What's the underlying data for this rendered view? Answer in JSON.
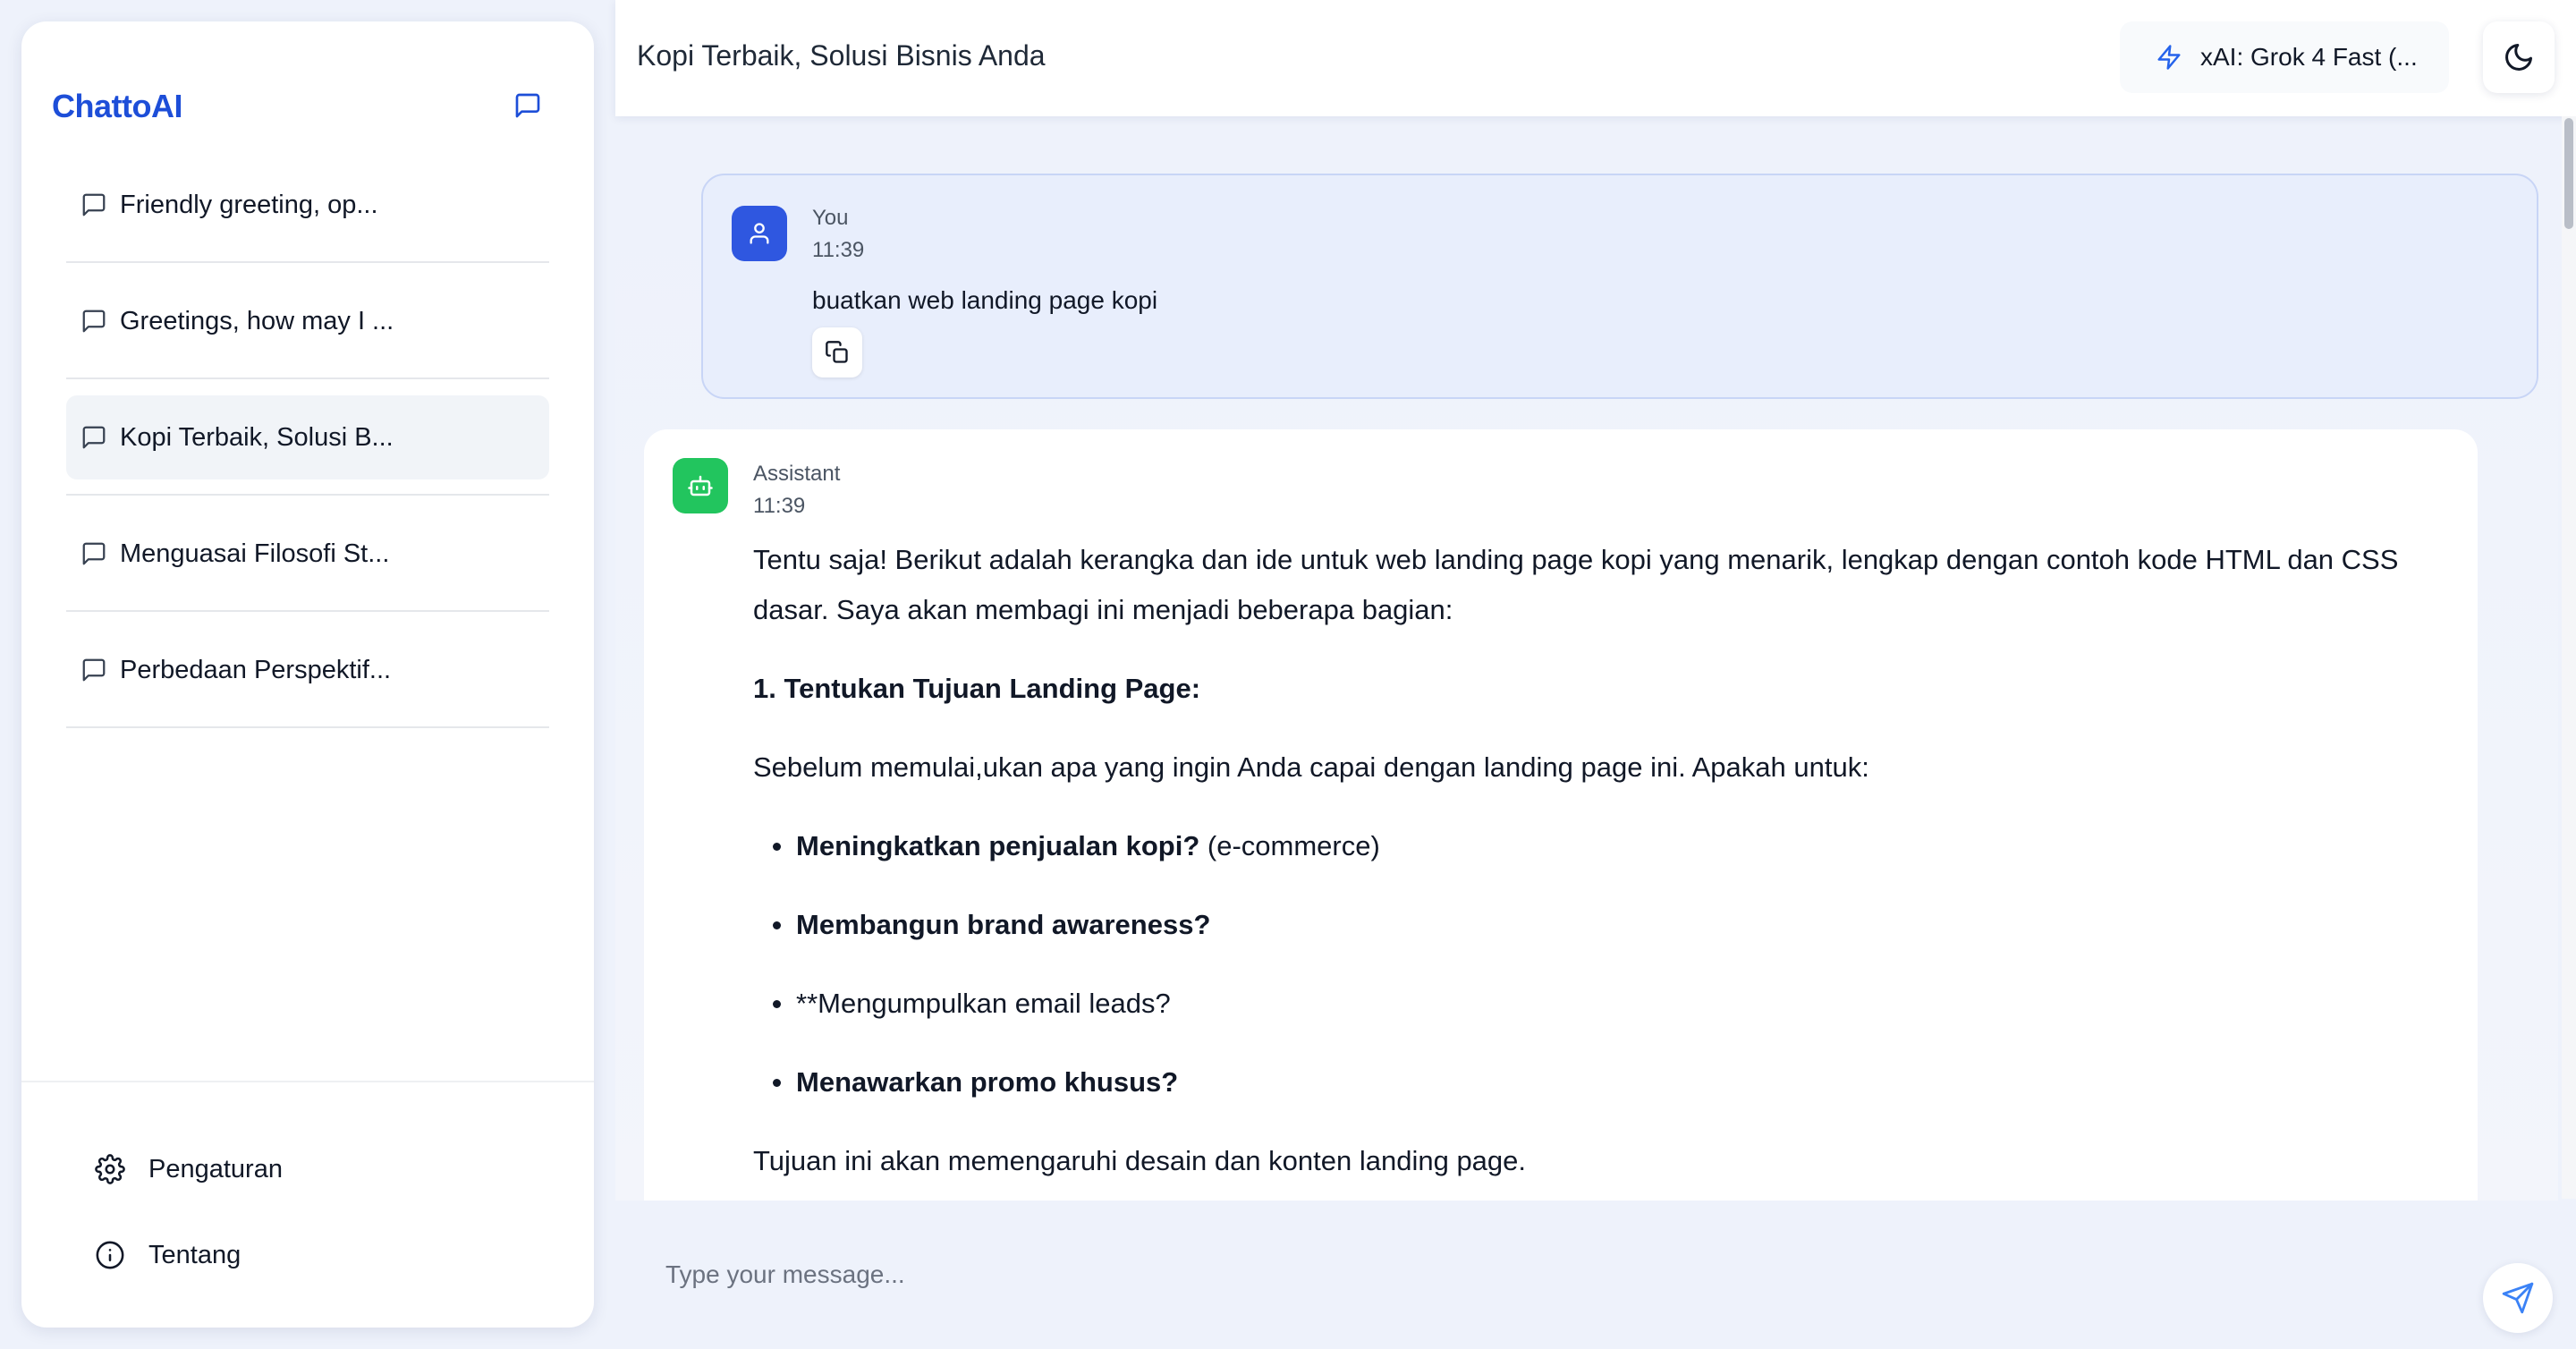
{
  "app": {
    "brand": "ChattoAI"
  },
  "sidebar": {
    "new_chat_icon": "message-square-icon",
    "chats": [
      {
        "label": "Friendly greeting, op...",
        "active": false
      },
      {
        "label": "Greetings, how may I ...",
        "active": false
      },
      {
        "label": "Kopi Terbaik, Solusi B...",
        "active": true
      },
      {
        "label": "Menguasai Filosofi St...",
        "active": false
      },
      {
        "label": "Perbedaan Perspektif...",
        "active": false
      }
    ],
    "footer": {
      "settings_label": "Pengaturan",
      "about_label": "Tentang"
    }
  },
  "header": {
    "title": "Kopi Terbaik, Solusi Bisnis Anda",
    "model_label": "xAI: Grok 4 Fast (...",
    "model_icon": "zap-icon",
    "theme_icon": "moon-icon"
  },
  "messages": {
    "user": {
      "name": "You",
      "time": "11:39",
      "text": "buatkan web landing page kopi"
    },
    "assistant": {
      "name": "Assistant",
      "time": "11:39",
      "intro": "Tentu saja! Berikut adalah kerangka dan ide untuk web landing page kopi yang menarik, lengkap dengan contoh kode HTML dan CSS dasar. Saya akan membagi ini menjadi beberapa bagian:",
      "heading": "1. Tentukan Tujuan Landing Page:",
      "lead": "Sebelum memulai,ukan apa yang ingin Anda capai dengan landing page ini. Apakah untuk:",
      "bullets": [
        {
          "bold": "Meningkatkan penjualan kopi?",
          "rest": " (e-commerce)"
        },
        {
          "bold": "Membangun brand awareness?",
          "rest": ""
        },
        {
          "bold": "",
          "rest": "**Mengumpulkan email leads?"
        },
        {
          "bold": "Menawarkan promo khusus?",
          "rest": ""
        }
      ],
      "outro": "Tujuan ini akan memengaruhi desain dan konten landing page."
    }
  },
  "composer": {
    "placeholder": "Type your message...",
    "send_icon": "send-icon"
  },
  "colors": {
    "brand": "#1d4ed8",
    "user_avatar": "#2f57e0",
    "bot_avatar": "#22c55e",
    "user_bubble": "#e8eefc"
  }
}
